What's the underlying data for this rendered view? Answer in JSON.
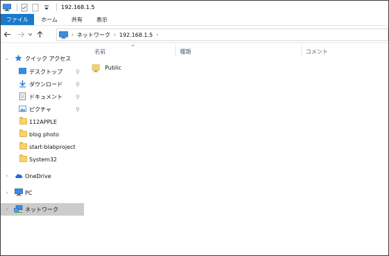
{
  "window": {
    "title": "192.168.1.5"
  },
  "ribbon": {
    "tabs": [
      "ファイル",
      "ホーム",
      "共有",
      "表示"
    ]
  },
  "address": {
    "crumbs": [
      "ネットワーク",
      "192.168.1.5"
    ]
  },
  "nav": {
    "quick_access": "クイック アクセス",
    "items": [
      "デスクトップ",
      "ダウンロード",
      "ドキュメント",
      "ピクチャ",
      "112APPLE",
      "blog photo",
      "start-blabproject",
      "System32"
    ],
    "onedrive": "OneDrive",
    "pc": "PC",
    "network": "ネットワーク"
  },
  "columns": {
    "name": "名前",
    "type": "種類",
    "comment": "コメント"
  },
  "files": [
    {
      "name": "Public"
    }
  ],
  "colors": {
    "file_tab": "#1979ca",
    "selected_nav": "#cccccc",
    "folder": "#f6d36b"
  }
}
